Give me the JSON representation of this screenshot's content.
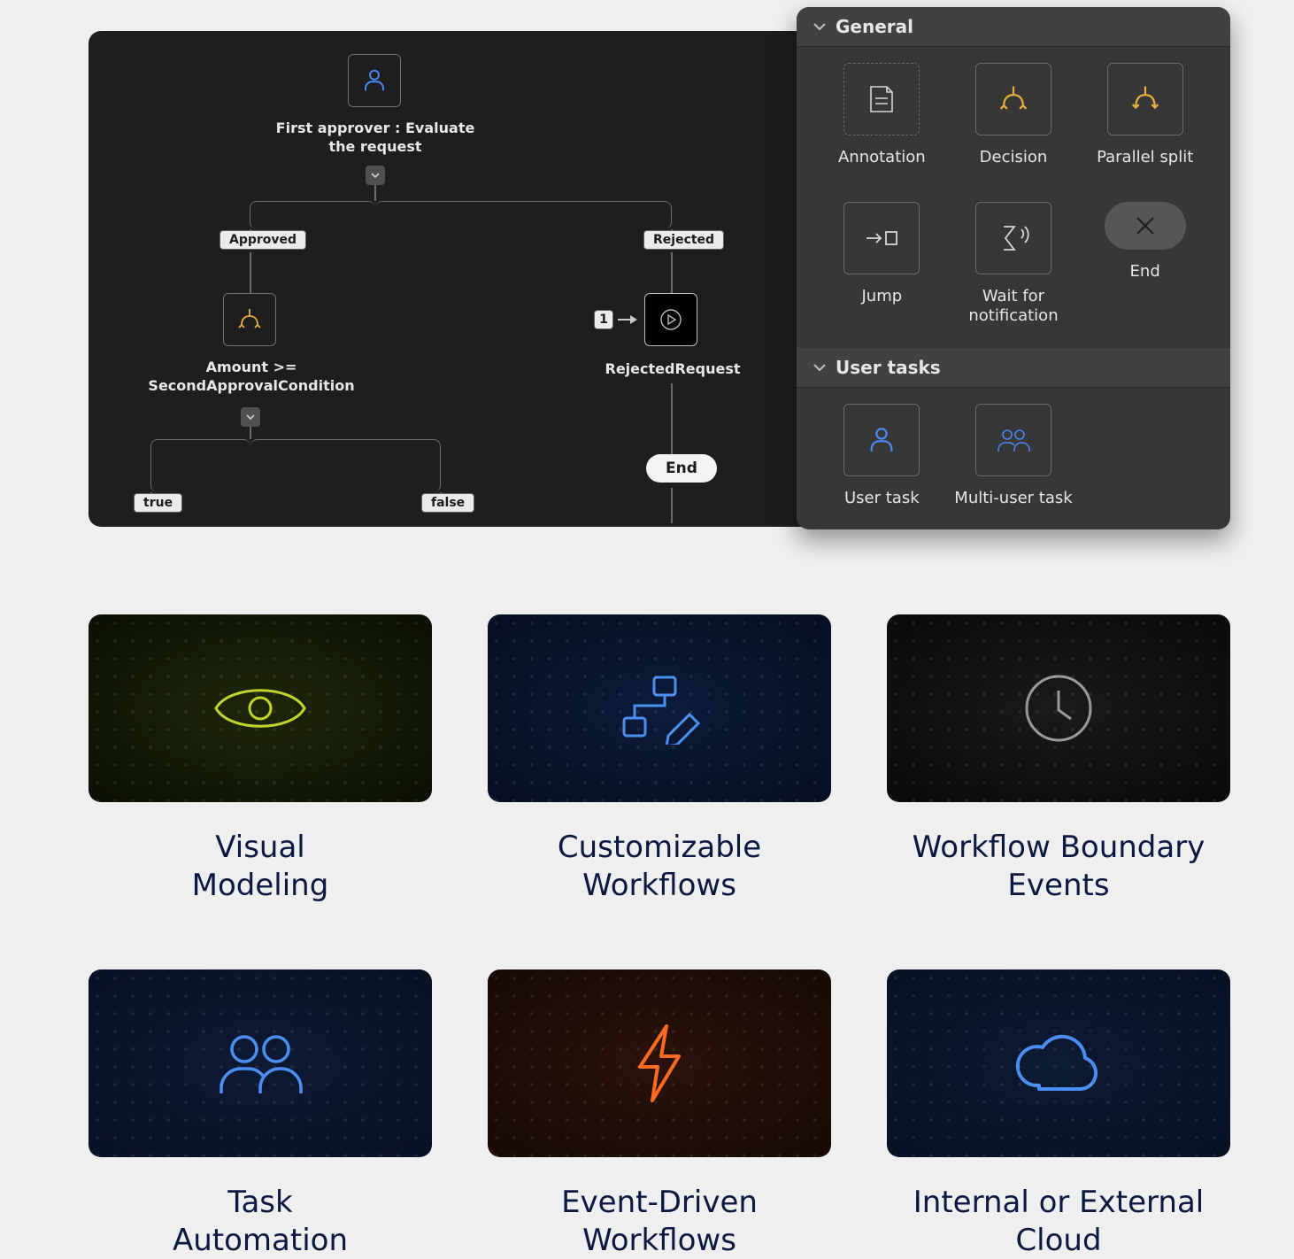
{
  "workflow": {
    "node1_label": "First approver : Evaluate the request",
    "branch_approved": "Approved",
    "branch_rejected": "Rejected",
    "node2_label": "Amount >= SecondApprovalCondition",
    "node3_label": "RejectedRequest",
    "branch_true": "true",
    "branch_false": "false",
    "end_label": "End",
    "seq_badge": "1",
    "icons": {
      "user": "user-icon",
      "decision": "decision-icon",
      "play": "play-icon"
    }
  },
  "palette": {
    "sections": [
      {
        "title": "General",
        "items": [
          {
            "label": "Annotation",
            "icon": "annotation-icon"
          },
          {
            "label": "Decision",
            "icon": "decision-icon"
          },
          {
            "label": "Parallel split",
            "icon": "parallel-split-icon"
          },
          {
            "label": "Jump",
            "icon": "jump-icon"
          },
          {
            "label": "Wait for notification",
            "icon": "wait-notification-icon"
          },
          {
            "label": "End",
            "icon": "end-icon"
          }
        ]
      },
      {
        "title": "User tasks",
        "items": [
          {
            "label": "User task",
            "icon": "user-task-icon"
          },
          {
            "label": "Multi-user task",
            "icon": "multi-user-task-icon"
          }
        ]
      }
    ]
  },
  "features": [
    {
      "title": "Visual\nModeling",
      "icon": "eye-icon",
      "bg": "bg-olive",
      "color": "#c0d52e"
    },
    {
      "title": "Customizable\nWorkflows",
      "icon": "blocks-pencil-icon",
      "bg": "bg-navy",
      "color": "#4a8ff0"
    },
    {
      "title": "Workflow Boundary\nEvents",
      "icon": "clock-icon",
      "bg": "bg-black",
      "color": "#9a9a9a"
    },
    {
      "title": "Task\nAutomation",
      "icon": "users-icon",
      "bg": "bg-navy2",
      "color": "#4a8ff0"
    },
    {
      "title": "Event-Driven\nWorkflows",
      "icon": "lightning-icon",
      "bg": "bg-rust",
      "color": "#ff6a1e"
    },
    {
      "title": "Internal or External\nCloud",
      "icon": "cloud-icon",
      "bg": "bg-navy3",
      "color": "#4a8ff0"
    }
  ]
}
